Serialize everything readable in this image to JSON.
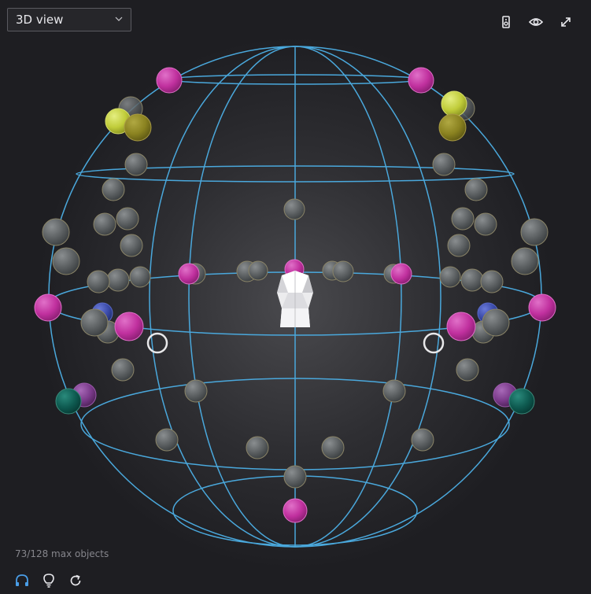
{
  "toolbar": {
    "view_mode": "3D view",
    "icons": [
      "speaker-icon",
      "eye-icon",
      "expand-icon"
    ]
  },
  "status": {
    "object_count": "73/128 max objects"
  },
  "bottom_bar": {
    "icons": [
      "headphones-icon",
      "lightbulb-icon",
      "reset-icon"
    ]
  },
  "colors": {
    "background": "#1e1e22",
    "wireframe": "#4aa8dc",
    "speaker_magenta": "#c83aa8",
    "speaker_gray": "#5e6264",
    "speaker_yellow_light": "#c4d040",
    "speaker_olive": "#8a8a22",
    "speaker_teal": "#0e5a50",
    "speaker_purple": "#7a3a8a",
    "speaker_blue": "#3a4aa8",
    "listener_ring": "#e8e8ea",
    "accent": "#4a9ee8"
  }
}
